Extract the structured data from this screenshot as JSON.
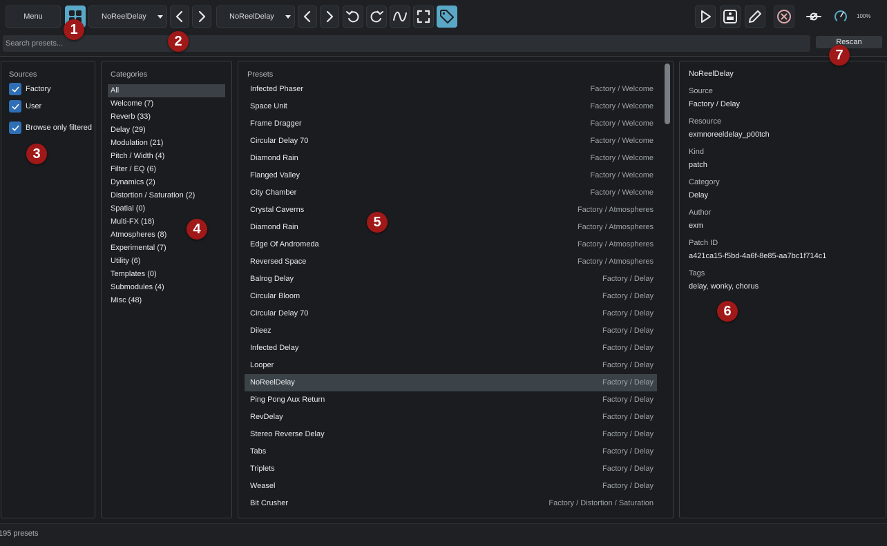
{
  "toolbar": {
    "menu_label": "Menu",
    "preset_combo_value": "NoReelDelay",
    "patch_combo_value": "NoReelDelay",
    "zoom_label": "100%"
  },
  "search": {
    "placeholder": "Search presets...",
    "value": "",
    "rescan_label": "Rescan"
  },
  "sources": {
    "title": "Sources",
    "items": [
      {
        "label": "Factory",
        "checked": true
      },
      {
        "label": "User",
        "checked": true
      }
    ],
    "browse_filtered": {
      "label": "Browse only filtered",
      "checked": true
    }
  },
  "categories": {
    "title": "Categories",
    "selected": "All",
    "items": [
      "All",
      "Welcome (7)",
      "Reverb (33)",
      "Delay (29)",
      "Modulation (21)",
      "Pitch / Width (4)",
      "Filter / EQ (6)",
      "Dynamics (2)",
      "Distortion / Saturation (2)",
      "Spatial (0)",
      "Multi-FX (18)",
      "Atmospheres (8)",
      "Experimental (7)",
      "Utility (6)",
      "Templates (0)",
      "Submodules (4)",
      "Misc (48)"
    ]
  },
  "presets": {
    "title": "Presets",
    "selected_index": 17,
    "rows": [
      {
        "name": "Infected Phaser",
        "source": "Factory / Welcome"
      },
      {
        "name": "Space Unit",
        "source": "Factory / Welcome"
      },
      {
        "name": "Frame Dragger",
        "source": "Factory / Welcome"
      },
      {
        "name": "Circular Delay 70",
        "source": "Factory / Welcome"
      },
      {
        "name": "Diamond Rain",
        "source": "Factory / Welcome"
      },
      {
        "name": "Flanged Valley",
        "source": "Factory / Welcome"
      },
      {
        "name": "City Chamber",
        "source": "Factory / Welcome"
      },
      {
        "name": "Crystal Caverns",
        "source": "Factory / Atmospheres"
      },
      {
        "name": "Diamond Rain",
        "source": "Factory / Atmospheres"
      },
      {
        "name": "Edge Of Andromeda",
        "source": "Factory / Atmospheres"
      },
      {
        "name": "Reversed Space",
        "source": "Factory / Atmospheres"
      },
      {
        "name": "Balrog Delay",
        "source": "Factory / Delay"
      },
      {
        "name": "Circular Bloom",
        "source": "Factory / Delay"
      },
      {
        "name": "Circular Delay 70",
        "source": "Factory / Delay"
      },
      {
        "name": "Dileez",
        "source": "Factory / Delay"
      },
      {
        "name": "Infected Delay",
        "source": "Factory / Delay"
      },
      {
        "name": "Looper",
        "source": "Factory / Delay"
      },
      {
        "name": "NoReelDelay",
        "source": "Factory / Delay"
      },
      {
        "name": "Ping Pong Aux Return",
        "source": "Factory / Delay"
      },
      {
        "name": "RevDelay",
        "source": "Factory / Delay"
      },
      {
        "name": "Stereo Reverse Delay",
        "source": "Factory / Delay"
      },
      {
        "name": "Tabs",
        "source": "Factory / Delay"
      },
      {
        "name": "Triplets",
        "source": "Factory / Delay"
      },
      {
        "name": "Weasel",
        "source": "Factory / Delay"
      },
      {
        "name": "Bit Crusher",
        "source": "Factory / Distortion / Saturation"
      }
    ]
  },
  "details": {
    "title": "NoReelDelay",
    "fields": [
      {
        "label": "Source",
        "value": "Factory / Delay"
      },
      {
        "label": "Resource",
        "value": "exmnoreeldelay_p00tch"
      },
      {
        "label": "Kind",
        "value": "patch"
      },
      {
        "label": "Category",
        "value": "Delay"
      },
      {
        "label": "Author",
        "value": "exm"
      },
      {
        "label": "Patch ID",
        "value": "a421ca15-f5bd-4a6f-8e85-aa7bc1f714c1"
      },
      {
        "label": "Tags",
        "value": "delay, wonky, chorus"
      }
    ]
  },
  "status": {
    "text": "195 presets"
  },
  "badges": [
    "1",
    "2",
    "3",
    "4",
    "5",
    "6",
    "7"
  ],
  "colors": {
    "accent": "#5aa8c8",
    "checkbox": "#2f6fb5",
    "badge": "#a01818",
    "close_icon": "#e0a6aa"
  }
}
